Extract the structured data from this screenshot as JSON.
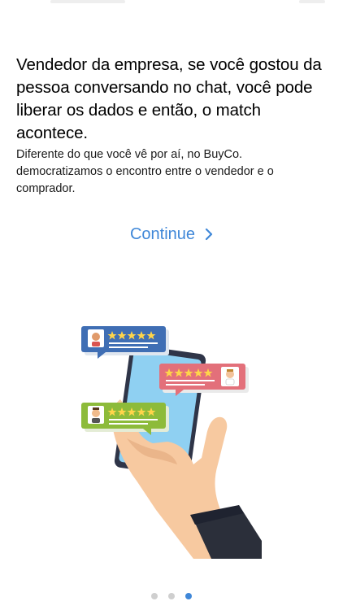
{
  "onboarding": {
    "headline": "Vendedor da empresa, se você gostou da pessoa conversando no chat, você pode liberar os dados e então, o match acontece.",
    "description": "Diferente do que você vê por aí, no BuyCo. democratizamos o encontro entre o vendedor e o comprador.",
    "continue_label": "Continue",
    "continue_icon": "chevron-right-icon"
  },
  "illustration": {
    "name": "hand-holding-phone-with-review-bubbles",
    "review_bubbles": [
      {
        "color": "#3f6eb4",
        "stars": 5
      },
      {
        "color": "#e3707a",
        "stars": 5
      },
      {
        "color": "#8dbb3a",
        "stars": 5
      }
    ]
  },
  "pager": {
    "page_count": 3,
    "active_page": 3,
    "active_color": "#3f87d8",
    "inactive_color": "#cfcfcf"
  },
  "theme": {
    "accent": "#3f87d8"
  }
}
